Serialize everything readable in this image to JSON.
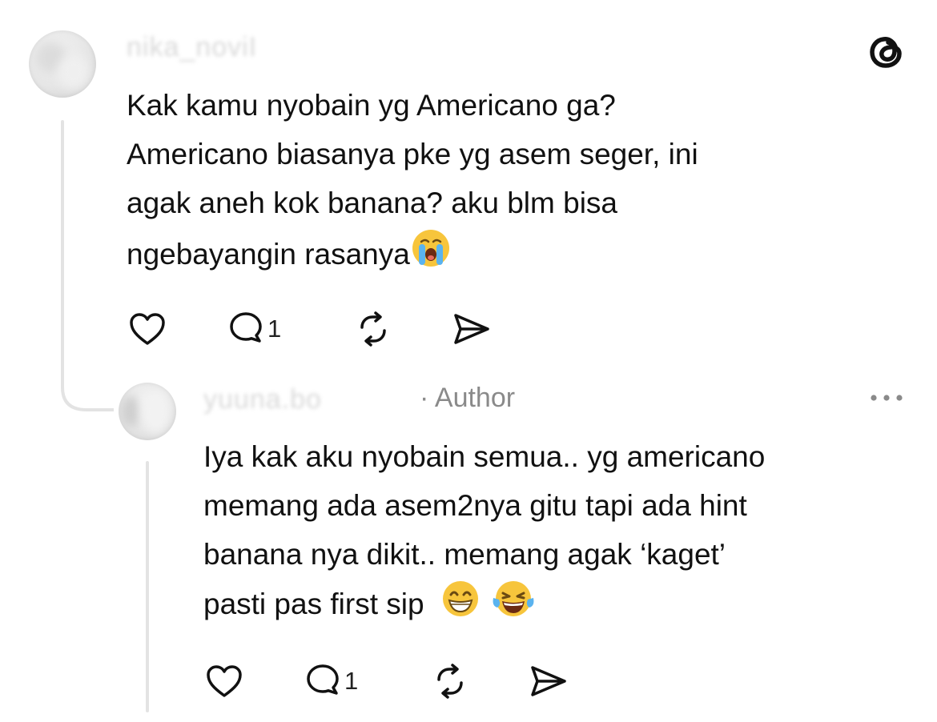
{
  "comment": {
    "username": "nika_noviI",
    "lines": [
      "Kak kamu nyobain yg Americano ga?",
      "Americano biasanya pke yg asem seger, ini",
      "agak aneh kok banana? aku blm bisa",
      "ngebayangin rasanya"
    ],
    "reply_count": "1"
  },
  "reply": {
    "username": "yuuna.bo",
    "author_tag": "· Author",
    "lines": [
      "Iya kak aku nyobain semua.. yg americano",
      "memang ada asem2nya gitu tapi ada hint",
      "banana nya dikit.. memang agak ‘kaget’",
      "pasti pas first sip"
    ],
    "reply_count": "1"
  },
  "icons": {
    "app": "threads-logo-icon",
    "like": "heart-icon",
    "reply": "comment-bubble-icon",
    "repost": "repost-icon",
    "share": "send-icon",
    "more": "more-options-icon",
    "emoji_1": "loudly-crying-face-emoji",
    "emoji_2": "grinning-face-emoji",
    "emoji_3": "rolling-laughing-face-emoji"
  },
  "colors": {
    "text": "#111111",
    "muted": "#8a8a8a",
    "thread_line": "#e3e3e3",
    "emoji_yellow": "#f7c53c"
  }
}
